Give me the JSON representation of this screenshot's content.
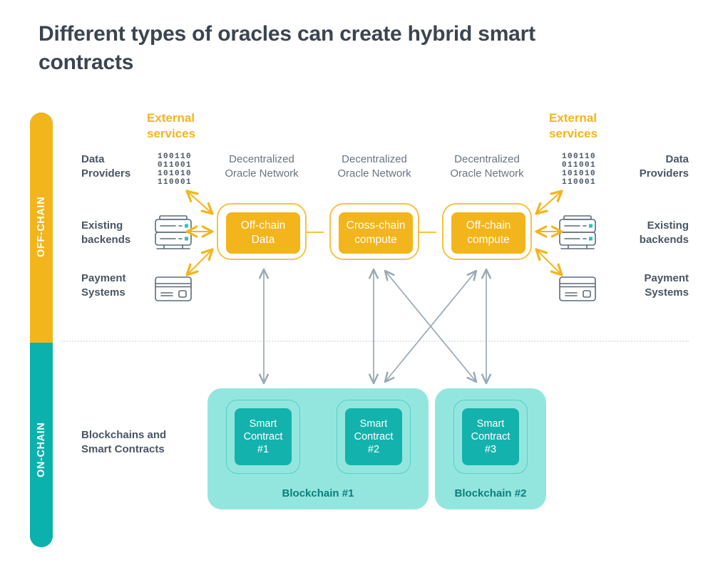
{
  "title": "Different types of oracles can create hybrid smart contracts",
  "rail": {
    "offchain_label": "OFF-CHAIN",
    "onchain_label": "ON-CHAIN",
    "offchain_color": "#f3b51c",
    "onchain_color": "#0bb2ad"
  },
  "external_services": {
    "left_heading": "External\nservices",
    "right_heading": "External\nservices",
    "heading_color": "#f3b51c"
  },
  "left_labels": [
    {
      "text": "Data\nProviders",
      "icon": "binary-data-icon"
    },
    {
      "text": "Existing\nbackends",
      "icon": "server-icon"
    },
    {
      "text": "Payment\nSystems",
      "icon": "credit-card-icon"
    }
  ],
  "right_labels": [
    {
      "text": "Data\nProviders",
      "icon": "binary-data-icon"
    },
    {
      "text": "Existing\nbackends",
      "icon": "server-icon"
    },
    {
      "text": "Payment\nSystems",
      "icon": "credit-card-icon"
    }
  ],
  "binary_icon_rows": [
    "100110",
    "011001",
    "101010",
    "110001"
  ],
  "oracle_networks": [
    {
      "caption": "Decentralized\nOracle Network",
      "box_label": "Off-chain\nData"
    },
    {
      "caption": "Decentralized\nOracle Network",
      "box_label": "Cross-chain\ncompute"
    },
    {
      "caption": "Decentralized\nOracle Network",
      "box_label": "Off-chain\ncompute"
    }
  ],
  "onchain": {
    "section_label": "Blockchains and\nSmart Contracts",
    "chains": [
      {
        "name": "Blockchain #1",
        "contracts": [
          "Smart\nContract\n#1",
          "Smart\nContract\n#2"
        ]
      },
      {
        "name": "Blockchain #2",
        "contracts": [
          "Smart\nContract\n#3"
        ]
      }
    ]
  },
  "colors": {
    "yellow": "#f3b51c",
    "yellow_border": "#f6c342",
    "teal": "#0bb2ad",
    "teal_light": "#93e6de",
    "teal_contract": "#14b2ac",
    "text_dark": "#3b4551",
    "text_gray": "#6a7480",
    "arrow_gray": "#9aaab4",
    "divider": "#e4e6e8"
  }
}
